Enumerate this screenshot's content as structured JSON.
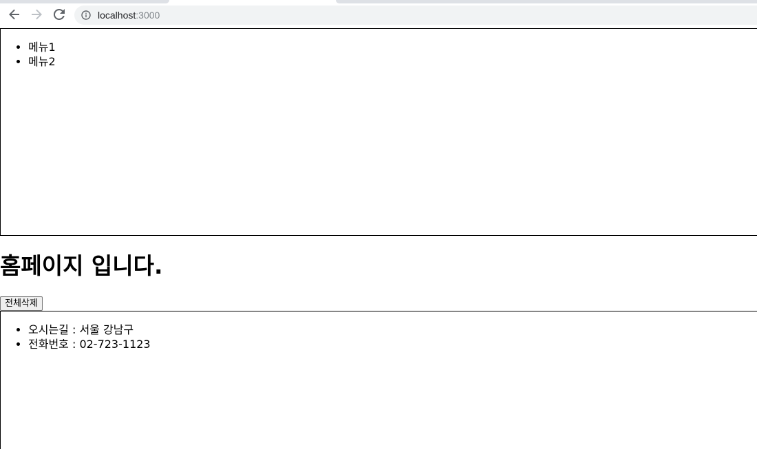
{
  "browser": {
    "url_host": "localhost",
    "url_port": ":3000"
  },
  "header": {
    "menu_items": [
      "메뉴1",
      "메뉴2"
    ]
  },
  "main": {
    "title": "홈페이지 입니다.",
    "delete_all_label": "전체삭제"
  },
  "footer": {
    "info_items": [
      "오시는길 : 서울 강남구",
      "전화번호 : 02-723-1123"
    ]
  }
}
